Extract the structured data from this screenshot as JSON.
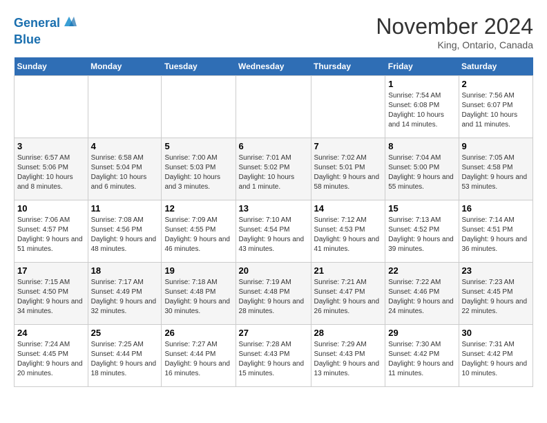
{
  "header": {
    "logo_line1": "General",
    "logo_line2": "Blue",
    "month": "November 2024",
    "location": "King, Ontario, Canada"
  },
  "weekdays": [
    "Sunday",
    "Monday",
    "Tuesday",
    "Wednesday",
    "Thursday",
    "Friday",
    "Saturday"
  ],
  "weeks": [
    [
      {
        "day": "",
        "info": ""
      },
      {
        "day": "",
        "info": ""
      },
      {
        "day": "",
        "info": ""
      },
      {
        "day": "",
        "info": ""
      },
      {
        "day": "",
        "info": ""
      },
      {
        "day": "1",
        "info": "Sunrise: 7:54 AM\nSunset: 6:08 PM\nDaylight: 10 hours and 14 minutes."
      },
      {
        "day": "2",
        "info": "Sunrise: 7:56 AM\nSunset: 6:07 PM\nDaylight: 10 hours and 11 minutes."
      }
    ],
    [
      {
        "day": "3",
        "info": "Sunrise: 6:57 AM\nSunset: 5:06 PM\nDaylight: 10 hours and 8 minutes."
      },
      {
        "day": "4",
        "info": "Sunrise: 6:58 AM\nSunset: 5:04 PM\nDaylight: 10 hours and 6 minutes."
      },
      {
        "day": "5",
        "info": "Sunrise: 7:00 AM\nSunset: 5:03 PM\nDaylight: 10 hours and 3 minutes."
      },
      {
        "day": "6",
        "info": "Sunrise: 7:01 AM\nSunset: 5:02 PM\nDaylight: 10 hours and 1 minute."
      },
      {
        "day": "7",
        "info": "Sunrise: 7:02 AM\nSunset: 5:01 PM\nDaylight: 9 hours and 58 minutes."
      },
      {
        "day": "8",
        "info": "Sunrise: 7:04 AM\nSunset: 5:00 PM\nDaylight: 9 hours and 55 minutes."
      },
      {
        "day": "9",
        "info": "Sunrise: 7:05 AM\nSunset: 4:58 PM\nDaylight: 9 hours and 53 minutes."
      }
    ],
    [
      {
        "day": "10",
        "info": "Sunrise: 7:06 AM\nSunset: 4:57 PM\nDaylight: 9 hours and 51 minutes."
      },
      {
        "day": "11",
        "info": "Sunrise: 7:08 AM\nSunset: 4:56 PM\nDaylight: 9 hours and 48 minutes."
      },
      {
        "day": "12",
        "info": "Sunrise: 7:09 AM\nSunset: 4:55 PM\nDaylight: 9 hours and 46 minutes."
      },
      {
        "day": "13",
        "info": "Sunrise: 7:10 AM\nSunset: 4:54 PM\nDaylight: 9 hours and 43 minutes."
      },
      {
        "day": "14",
        "info": "Sunrise: 7:12 AM\nSunset: 4:53 PM\nDaylight: 9 hours and 41 minutes."
      },
      {
        "day": "15",
        "info": "Sunrise: 7:13 AM\nSunset: 4:52 PM\nDaylight: 9 hours and 39 minutes."
      },
      {
        "day": "16",
        "info": "Sunrise: 7:14 AM\nSunset: 4:51 PM\nDaylight: 9 hours and 36 minutes."
      }
    ],
    [
      {
        "day": "17",
        "info": "Sunrise: 7:15 AM\nSunset: 4:50 PM\nDaylight: 9 hours and 34 minutes."
      },
      {
        "day": "18",
        "info": "Sunrise: 7:17 AM\nSunset: 4:49 PM\nDaylight: 9 hours and 32 minutes."
      },
      {
        "day": "19",
        "info": "Sunrise: 7:18 AM\nSunset: 4:48 PM\nDaylight: 9 hours and 30 minutes."
      },
      {
        "day": "20",
        "info": "Sunrise: 7:19 AM\nSunset: 4:48 PM\nDaylight: 9 hours and 28 minutes."
      },
      {
        "day": "21",
        "info": "Sunrise: 7:21 AM\nSunset: 4:47 PM\nDaylight: 9 hours and 26 minutes."
      },
      {
        "day": "22",
        "info": "Sunrise: 7:22 AM\nSunset: 4:46 PM\nDaylight: 9 hours and 24 minutes."
      },
      {
        "day": "23",
        "info": "Sunrise: 7:23 AM\nSunset: 4:45 PM\nDaylight: 9 hours and 22 minutes."
      }
    ],
    [
      {
        "day": "24",
        "info": "Sunrise: 7:24 AM\nSunset: 4:45 PM\nDaylight: 9 hours and 20 minutes."
      },
      {
        "day": "25",
        "info": "Sunrise: 7:25 AM\nSunset: 4:44 PM\nDaylight: 9 hours and 18 minutes."
      },
      {
        "day": "26",
        "info": "Sunrise: 7:27 AM\nSunset: 4:44 PM\nDaylight: 9 hours and 16 minutes."
      },
      {
        "day": "27",
        "info": "Sunrise: 7:28 AM\nSunset: 4:43 PM\nDaylight: 9 hours and 15 minutes."
      },
      {
        "day": "28",
        "info": "Sunrise: 7:29 AM\nSunset: 4:43 PM\nDaylight: 9 hours and 13 minutes."
      },
      {
        "day": "29",
        "info": "Sunrise: 7:30 AM\nSunset: 4:42 PM\nDaylight: 9 hours and 11 minutes."
      },
      {
        "day": "30",
        "info": "Sunrise: 7:31 AM\nSunset: 4:42 PM\nDaylight: 9 hours and 10 minutes."
      }
    ]
  ]
}
